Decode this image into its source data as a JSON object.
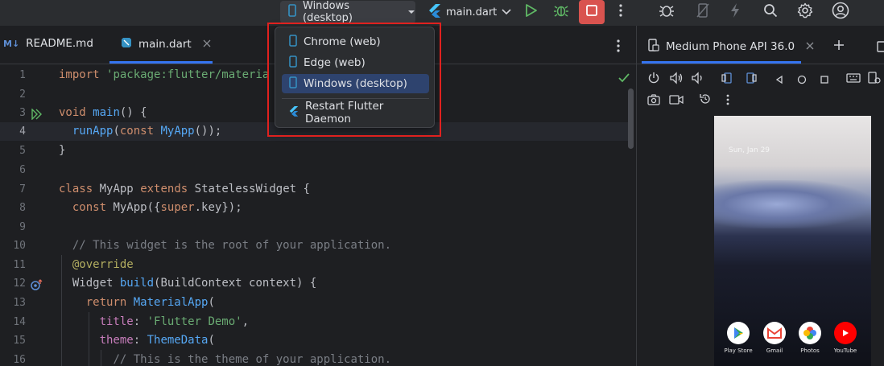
{
  "toolbar": {
    "device_selector": "Windows (desktop)",
    "run_config": "main.dart"
  },
  "editor_tabs": [
    {
      "label": "README.md",
      "badge": "M↓"
    },
    {
      "label": "main.dart"
    }
  ],
  "device_menu": {
    "items": [
      {
        "label": "Chrome (web)",
        "selected": false
      },
      {
        "label": "Edge (web)",
        "selected": false
      },
      {
        "label": "Windows (desktop)",
        "selected": true
      }
    ],
    "action": "Restart Flutter Daemon"
  },
  "line_numbers": [
    "1",
    "2",
    "3",
    "4",
    "5",
    "6",
    "7",
    "8",
    "9",
    "10",
    "11",
    "12",
    "13",
    "14",
    "15",
    "16"
  ],
  "code": {
    "l1_kw": "import",
    "l1_str": "'package:flutter/materia",
    "l3_kw": "void",
    "l3_fn": "main",
    "l3_rest": "() {",
    "l4_fn": "runApp",
    "l4_a": "(",
    "l4_kw": "const",
    "l4_cls": "MyApp",
    "l4_b": "());",
    "l5": "}",
    "l7_kw1": "class",
    "l7_name": "MyApp",
    "l7_kw2": "extends",
    "l7_base": "StatelessWidget {",
    "l8_kw": "const",
    "l8_cls": "MyApp",
    "l8_a": "({",
    "l8_kw2": "super",
    "l8_b": ".key});",
    "l10": "// This widget is the root of your application.",
    "l11": "@override",
    "l12_type": "Widget",
    "l12_fn": "build",
    "l12_rest": "(BuildContext context) {",
    "l13_kw": "return",
    "l13_cls": "MaterialApp",
    "l13_rest": "(",
    "l14_prop": "title",
    "l14_colon": ": ",
    "l14_str": "'Flutter Demo'",
    "l14_end": ",",
    "l15_prop": "theme",
    "l15_colon": ": ",
    "l15_cls": "ThemeData",
    "l15_end": "(",
    "l16": "// This is the theme of your application."
  },
  "running_devices": {
    "tab_label": "Medium Phone API 36.0"
  },
  "phone": {
    "date": "Sun, Jan 29",
    "apps": [
      "Play Store",
      "Gmail",
      "Photos",
      "YouTube"
    ]
  },
  "colors": {
    "accent": "#3574f0",
    "stop_button": "#d9534f",
    "highlight_box": "#e0211f"
  }
}
